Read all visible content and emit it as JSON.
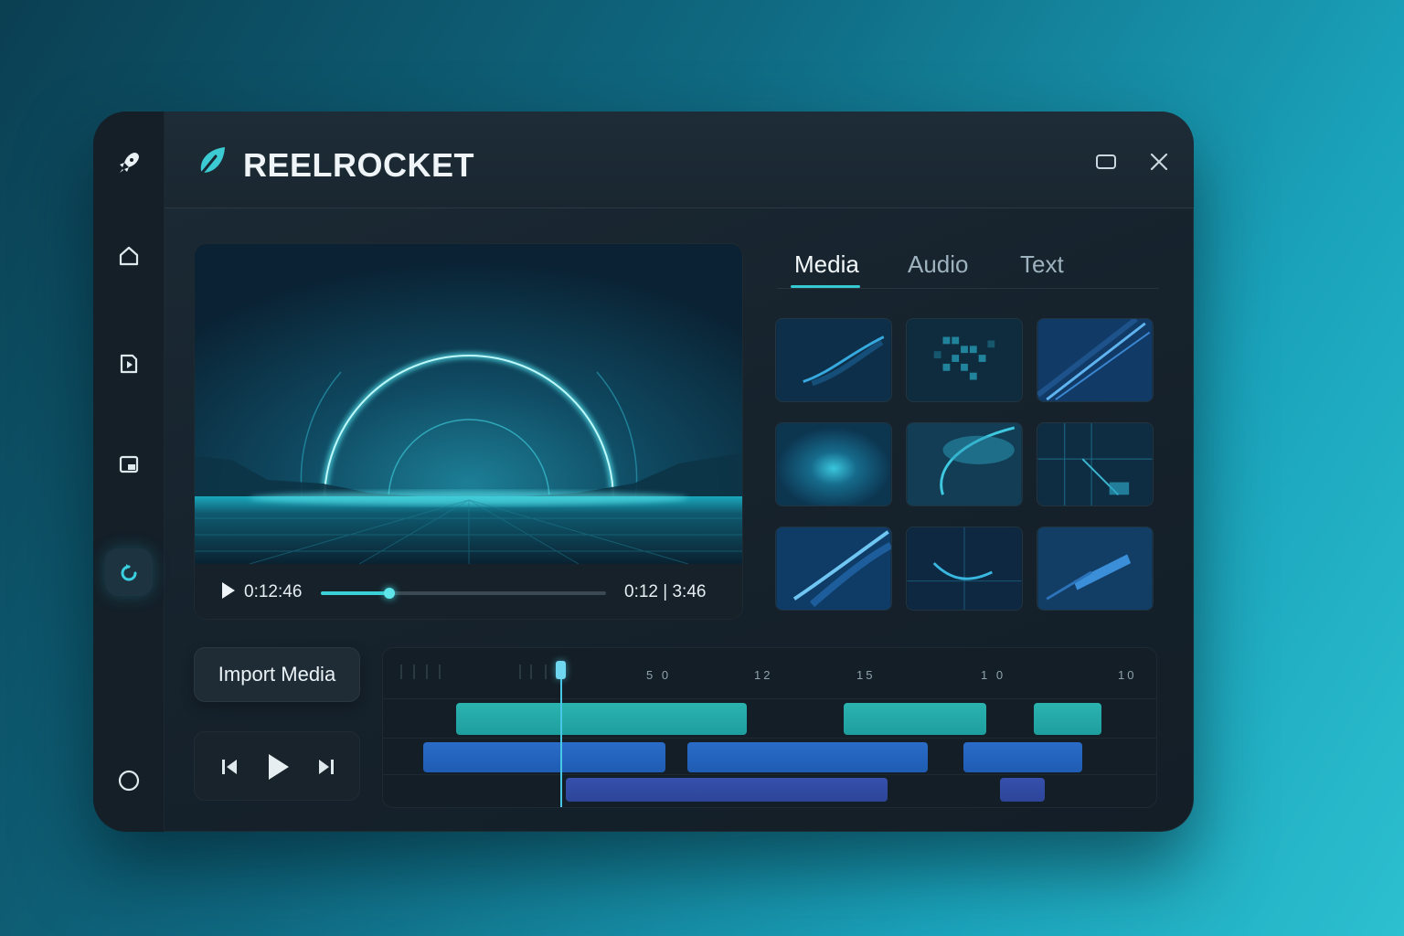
{
  "app": {
    "title": "REELROCKET"
  },
  "sidebar": {
    "items": [
      {
        "icon": "rocket-icon"
      },
      {
        "icon": "home-icon"
      },
      {
        "icon": "video-icon"
      },
      {
        "icon": "pip-icon"
      },
      {
        "icon": "refresh-icon",
        "active": true
      },
      {
        "icon": "circle-icon"
      }
    ]
  },
  "player": {
    "current_time": "0:12:46",
    "total_time": "0:12 | 3:46",
    "progress": 0.24
  },
  "tabs": [
    {
      "label": "Media",
      "active": true
    },
    {
      "label": "Audio"
    },
    {
      "label": "Text"
    }
  ],
  "import_label": "Import Media",
  "timeline": {
    "ruler_labels": [
      "5 0",
      "12",
      "15",
      "1 0",
      "10"
    ]
  },
  "colors": {
    "accent": "#35c9d1",
    "clip_teal": "#2bb3b0",
    "clip_blue": "#2a6cc8",
    "clip_indigo": "#3650ad"
  }
}
